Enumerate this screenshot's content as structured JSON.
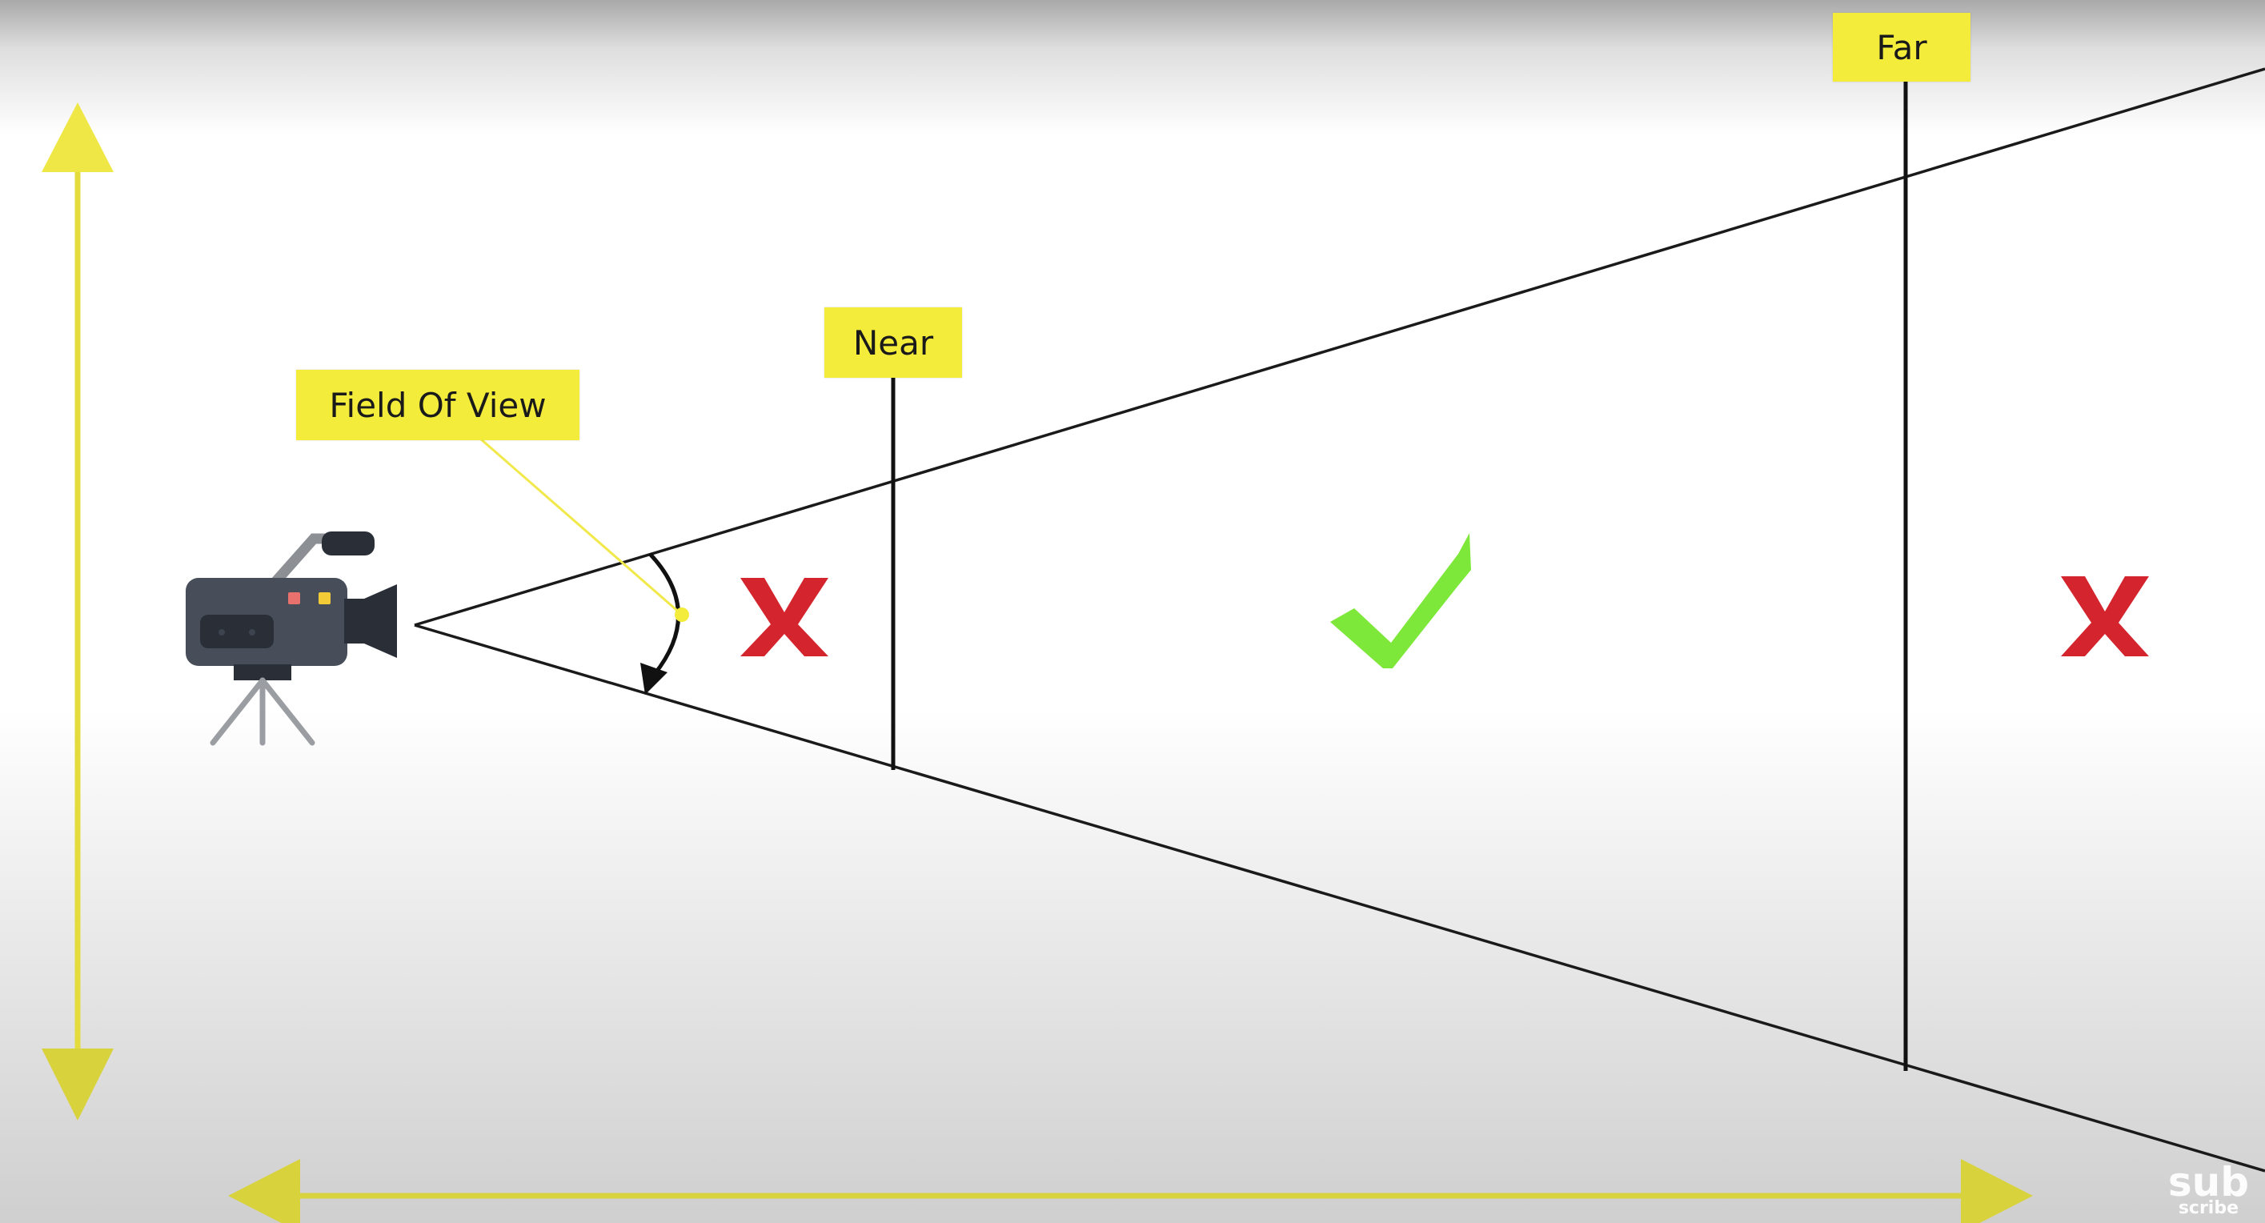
{
  "labels": {
    "field_of_view": "Field Of View",
    "near": "Near",
    "far": "Far"
  },
  "watermark": {
    "main": "sub",
    "sub": "scribe"
  },
  "icons": {
    "camera": "video-camera-on-tripod-icon",
    "excluded_near": "red-x-icon",
    "visible_region": "green-checkmark-icon",
    "excluded_far": "red-x-icon"
  },
  "colors": {
    "label_background": "#f4ec3a",
    "axis_arrows": "#e4dc3c",
    "frustum_lines": "#1a1a1a",
    "cross": "#d4252e",
    "check": "#7ee83a",
    "camera_body": "#474e5a"
  }
}
